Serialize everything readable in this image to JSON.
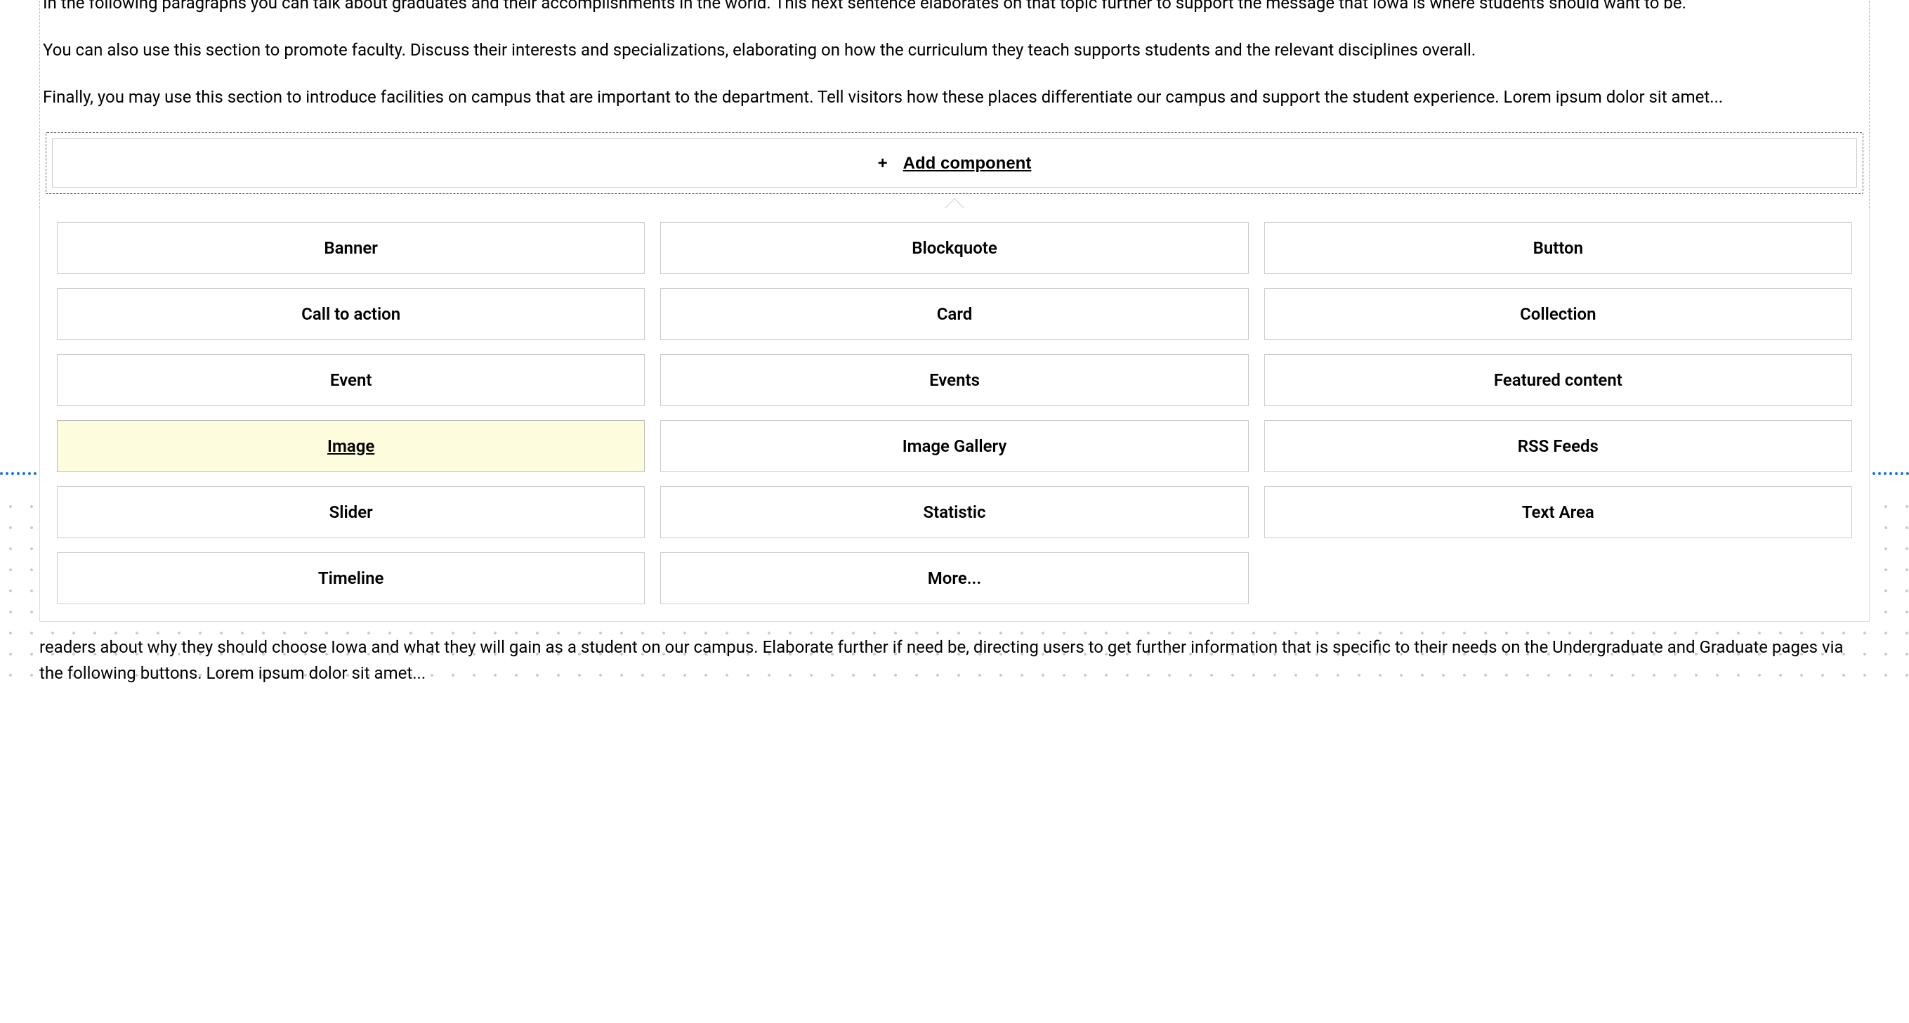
{
  "content": {
    "paragraph1": "In the following paragraphs you can talk about graduates and their accomplishments in the world. This next sentence elaborates on that topic further to support the message that Iowa is where students should want to be.",
    "paragraph2": "You can also use this section to promote faculty. Discuss their interests and specializations, elaborating on how the curriculum they teach supports students and the relevant disciplines overall.",
    "paragraph3": "Finally, you may use this section to introduce facilities on campus that are important to the department. Tell visitors how these places differentiate our campus and support the student experience. Lorem ipsum dolor sit amet...",
    "paragraph4": "readers about why they should choose Iowa and what they will gain as a student on our campus. Elaborate further if need be, directing users to get further information that is specific to their needs on the Undergraduate and Graduate pages via the following buttons. Lorem ipsum dolor sit amet..."
  },
  "addComponent": {
    "label": "Add component",
    "plus": "+"
  },
  "componentOptions": [
    {
      "label": "Banner",
      "highlighted": false
    },
    {
      "label": "Blockquote",
      "highlighted": false
    },
    {
      "label": "Button",
      "highlighted": false
    },
    {
      "label": "Call to action",
      "highlighted": false
    },
    {
      "label": "Card",
      "highlighted": false
    },
    {
      "label": "Collection",
      "highlighted": false
    },
    {
      "label": "Event",
      "highlighted": false
    },
    {
      "label": "Events",
      "highlighted": false
    },
    {
      "label": "Featured content",
      "highlighted": false
    },
    {
      "label": "Image",
      "highlighted": true
    },
    {
      "label": "Image Gallery",
      "highlighted": false
    },
    {
      "label": "RSS Feeds",
      "highlighted": false
    },
    {
      "label": "Slider",
      "highlighted": false
    },
    {
      "label": "Statistic",
      "highlighted": false
    },
    {
      "label": "Text Area",
      "highlighted": false
    },
    {
      "label": "Timeline",
      "highlighted": false
    },
    {
      "label": "More...",
      "highlighted": false
    }
  ]
}
